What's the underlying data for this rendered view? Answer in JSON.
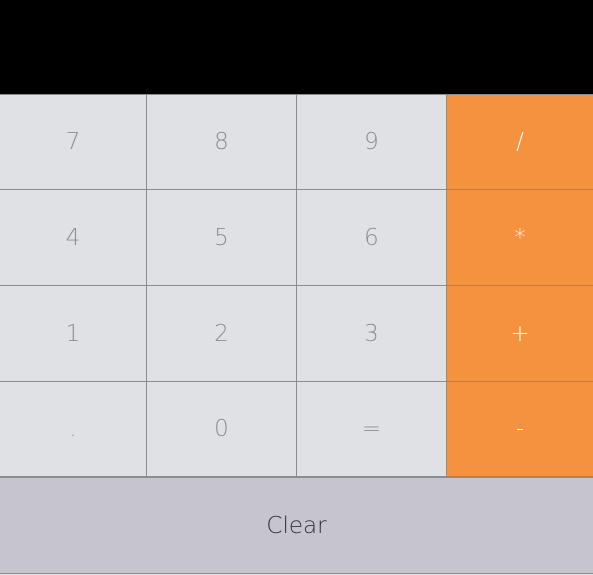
{
  "display": {
    "value": ""
  },
  "keys": {
    "row1": [
      "7",
      "8",
      "9",
      "/"
    ],
    "row2": [
      "4",
      "5",
      "6",
      "*"
    ],
    "row3": [
      "1",
      "2",
      "3",
      "+"
    ],
    "row4": [
      ".",
      "0",
      "=",
      "-"
    ]
  },
  "clear_label": "Clear",
  "colors": {
    "display_bg": "#000000",
    "key_bg": "#e0e1e5",
    "operator_bg": "#f5923e",
    "clear_bg": "#c5c4cf",
    "key_text": "#8e8e8e",
    "operator_text": "#ffffff"
  }
}
